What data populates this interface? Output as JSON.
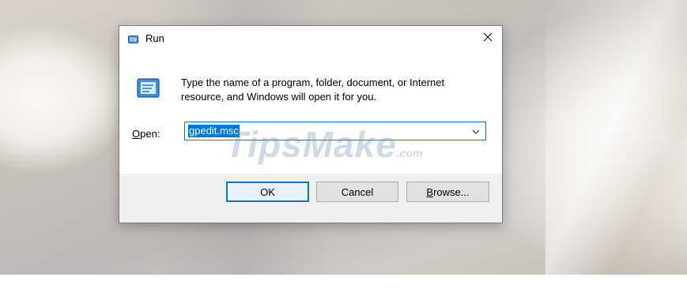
{
  "window": {
    "title": "Run",
    "icon": "run-icon",
    "close_icon": "close-icon"
  },
  "content": {
    "icon": "run-icon",
    "description_line1": "Type the name of a program, folder, document, or Internet",
    "description_line2": "resource, and Windows will open it for you.",
    "open_label_mnemonic": "O",
    "open_label_rest": "pen:",
    "combo_value": "gpedit.msc",
    "combo_arrow_icon": "chevron-down-icon"
  },
  "buttons": {
    "ok_label": "OK",
    "cancel_label": "Cancel",
    "browse_mnemonic": "B",
    "browse_rest": "rowse..."
  },
  "watermark": {
    "text": "TipsMake",
    "suffix": ".com"
  },
  "colors": {
    "accent": "#0078d7",
    "dialog_bg": "#f0f0f0",
    "button_bg": "#e1e1e1"
  }
}
